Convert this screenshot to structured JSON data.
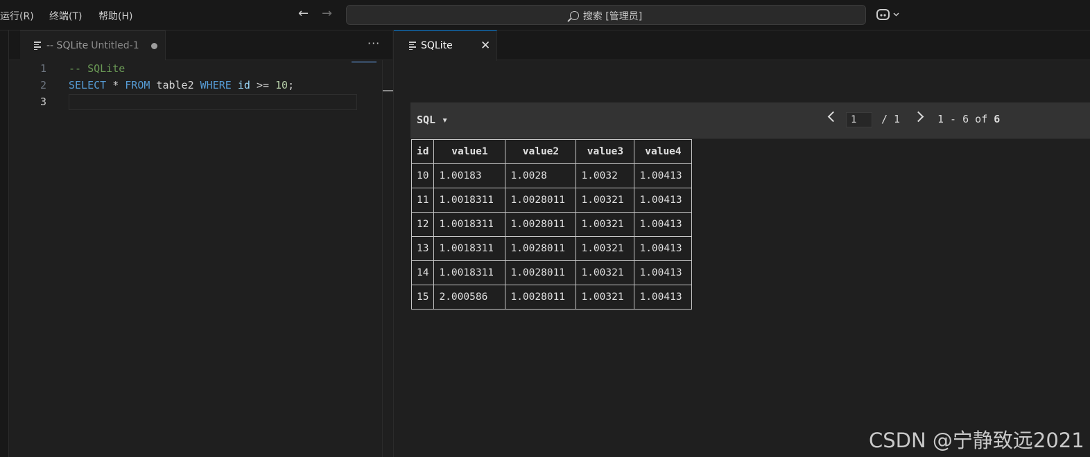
{
  "menu": {
    "run": "运行(R)",
    "terminal": "终端(T)",
    "help": "帮助(H)"
  },
  "nav": {
    "back": "←",
    "forward": "→"
  },
  "search": {
    "text": "搜索 [管理员]"
  },
  "editor": {
    "tab_title": "-- SQLite",
    "tab_sub": "Untitled-1",
    "more": "···",
    "line_numbers": [
      "1",
      "2",
      "3"
    ],
    "line1": "-- SQLite",
    "line2": {
      "kw1": "SELECT",
      "star": " * ",
      "kw2": "FROM",
      "table": " table2 ",
      "kw3": "WHERE",
      "col": " id ",
      "op": ">= ",
      "num": "10",
      "end": ";"
    }
  },
  "results": {
    "tab_title": "SQLite",
    "close": "✕",
    "sql_label": "SQL ▾",
    "page_value": "1",
    "page_total": "/ 1",
    "range_text": "1 - 6 of ",
    "range_total": "6",
    "columns": [
      "id",
      "value1",
      "value2",
      "value3",
      "value4"
    ],
    "rows": [
      [
        "10",
        "1.00183",
        "1.0028",
        "1.0032",
        "1.00413"
      ],
      [
        "11",
        "1.0018311",
        "1.0028011",
        "1.00321",
        "1.00413"
      ],
      [
        "12",
        "1.0018311",
        "1.0028011",
        "1.00321",
        "1.00413"
      ],
      [
        "13",
        "1.0018311",
        "1.0028011",
        "1.00321",
        "1.00413"
      ],
      [
        "14",
        "1.0018311",
        "1.0028011",
        "1.00321",
        "1.00413"
      ],
      [
        "15",
        "2.000586",
        "1.0028011",
        "1.00321",
        "1.00413"
      ]
    ]
  },
  "watermark": "CSDN @宁静致远2021",
  "colors": {
    "accent": "#0078d4",
    "keyword": "#569cd6",
    "comment": "#6a9955",
    "number": "#b5cea8",
    "identifier": "#9cdcfe"
  }
}
